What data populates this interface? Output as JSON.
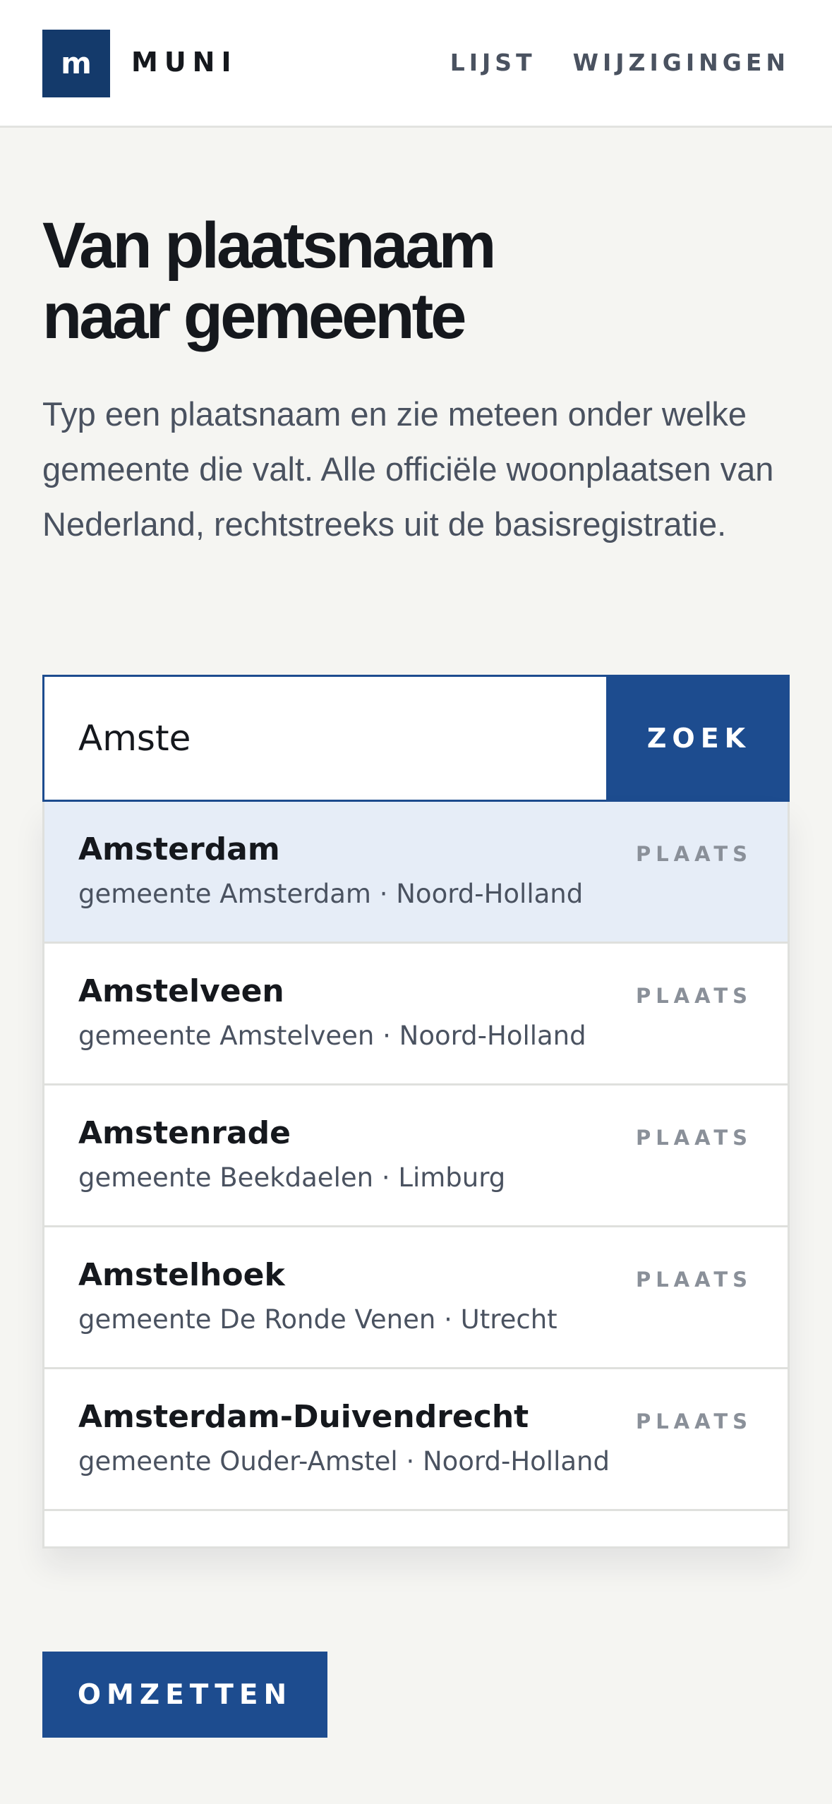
{
  "header": {
    "logo_letter": "m",
    "brand": "MUNI",
    "nav": [
      {
        "label": "LIJST"
      },
      {
        "label": "WIJZIGINGEN"
      }
    ]
  },
  "hero": {
    "title_line1": "Van plaatsnaam",
    "title_line2": "naar gemeente",
    "lead": "Typ een plaatsnaam en zie meteen onder welke gemeente die valt. Alle officiële woonplaatsen van Nederland, rechtstreeks uit de basisregistratie."
  },
  "search": {
    "value": "Amste",
    "button_label": "ZOEK"
  },
  "suggestions": [
    {
      "name": "Amsterdam",
      "sub": "gemeente Amsterdam · Noord-Holland",
      "tag": "PLAATS",
      "active": true
    },
    {
      "name": "Amstelveen",
      "sub": "gemeente Amstelveen · Noord-Holland",
      "tag": "PLAATS",
      "active": false
    },
    {
      "name": "Amstenrade",
      "sub": "gemeente Beekdaelen · Limburg",
      "tag": "PLAATS",
      "active": false
    },
    {
      "name": "Amstelhoek",
      "sub": "gemeente De Ronde Venen · Utrecht",
      "tag": "PLAATS",
      "active": false
    },
    {
      "name": "Amsterdam-Duivendrecht",
      "sub": "gemeente Ouder-Amstel · Noord-Holland",
      "tag": "PLAATS",
      "active": false
    }
  ],
  "convert": {
    "button_label": "OMZETTEN"
  },
  "colors": {
    "primary": "#1d4c8f",
    "logo": "#143a6b",
    "highlight": "#e6edf7",
    "background": "#f5f5f2"
  }
}
